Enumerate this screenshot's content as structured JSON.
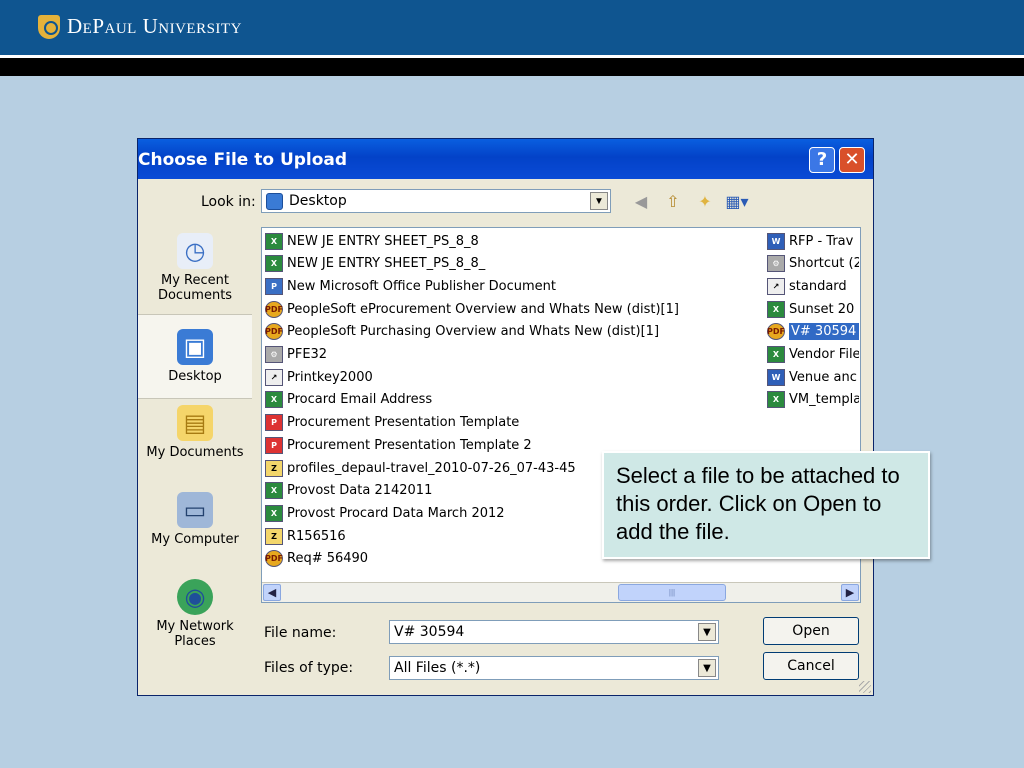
{
  "header": {
    "logo_text": "DePaul University"
  },
  "dialog": {
    "title": "Choose File to Upload",
    "help_label": "?",
    "close_label": "✕",
    "look_in_label": "Look in:",
    "look_in_value": "Desktop",
    "places": [
      {
        "label": "My Recent Documents",
        "icon": "recent-documents-icon"
      },
      {
        "label": "Desktop",
        "icon": "desktop-icon"
      },
      {
        "label": "My Documents",
        "icon": "my-documents-icon"
      },
      {
        "label": "My Computer",
        "icon": "my-computer-icon"
      },
      {
        "label": "My Network Places",
        "icon": "network-places-icon"
      }
    ],
    "files_col1": [
      {
        "name": "NEW JE ENTRY SHEET_PS_8_8",
        "type": "xls"
      },
      {
        "name": "NEW JE ENTRY SHEET_PS_8_8_",
        "type": "xls"
      },
      {
        "name": "New Microsoft Office Publisher Document",
        "type": "pub"
      },
      {
        "name": "PeopleSoft eProcurement Overview and Whats New (dist)[1]",
        "type": "pdf"
      },
      {
        "name": "PeopleSoft Purchasing Overview and Whats New (dist)[1]",
        "type": "pdf"
      },
      {
        "name": "PFE32",
        "type": "exe"
      },
      {
        "name": "Printkey2000",
        "type": "lnk"
      },
      {
        "name": "Procard Email Address",
        "type": "xls"
      },
      {
        "name": "Procurement Presentation Template",
        "type": "ppt"
      },
      {
        "name": "Procurement Presentation Template 2",
        "type": "ppt"
      },
      {
        "name": "profiles_depaul-travel_2010-07-26_07-43-45",
        "type": "zip"
      },
      {
        "name": "Provost Data 2142011",
        "type": "xls"
      },
      {
        "name": "Provost Procard Data March 2012",
        "type": "xls"
      },
      {
        "name": "R156516",
        "type": "zip"
      },
      {
        "name": "Req# 56490",
        "type": "pdf"
      }
    ],
    "files_col2": [
      {
        "name": "RFP - Trav",
        "type": "doc"
      },
      {
        "name": "Shortcut (2",
        "type": "exe"
      },
      {
        "name": "standard",
        "type": "lnk"
      },
      {
        "name": "Sunset 20",
        "type": "xls"
      },
      {
        "name": "V# 30594",
        "type": "pdf",
        "selected": true
      },
      {
        "name": "Vendor File",
        "type": "xls"
      },
      {
        "name": "Venue anc",
        "type": "doc"
      },
      {
        "name": "VM_templa",
        "type": "xls"
      }
    ],
    "scroll_thumb_grip": "|||",
    "file_name_label": "File name:",
    "file_name_value": "V# 30594",
    "file_type_label": "Files of type:",
    "file_type_value": "All Files (*.*)",
    "open_label": "Open",
    "cancel_label": "Cancel"
  },
  "callout": {
    "text": "Select a file to be attached to this order.  Click on Open to add the file."
  }
}
